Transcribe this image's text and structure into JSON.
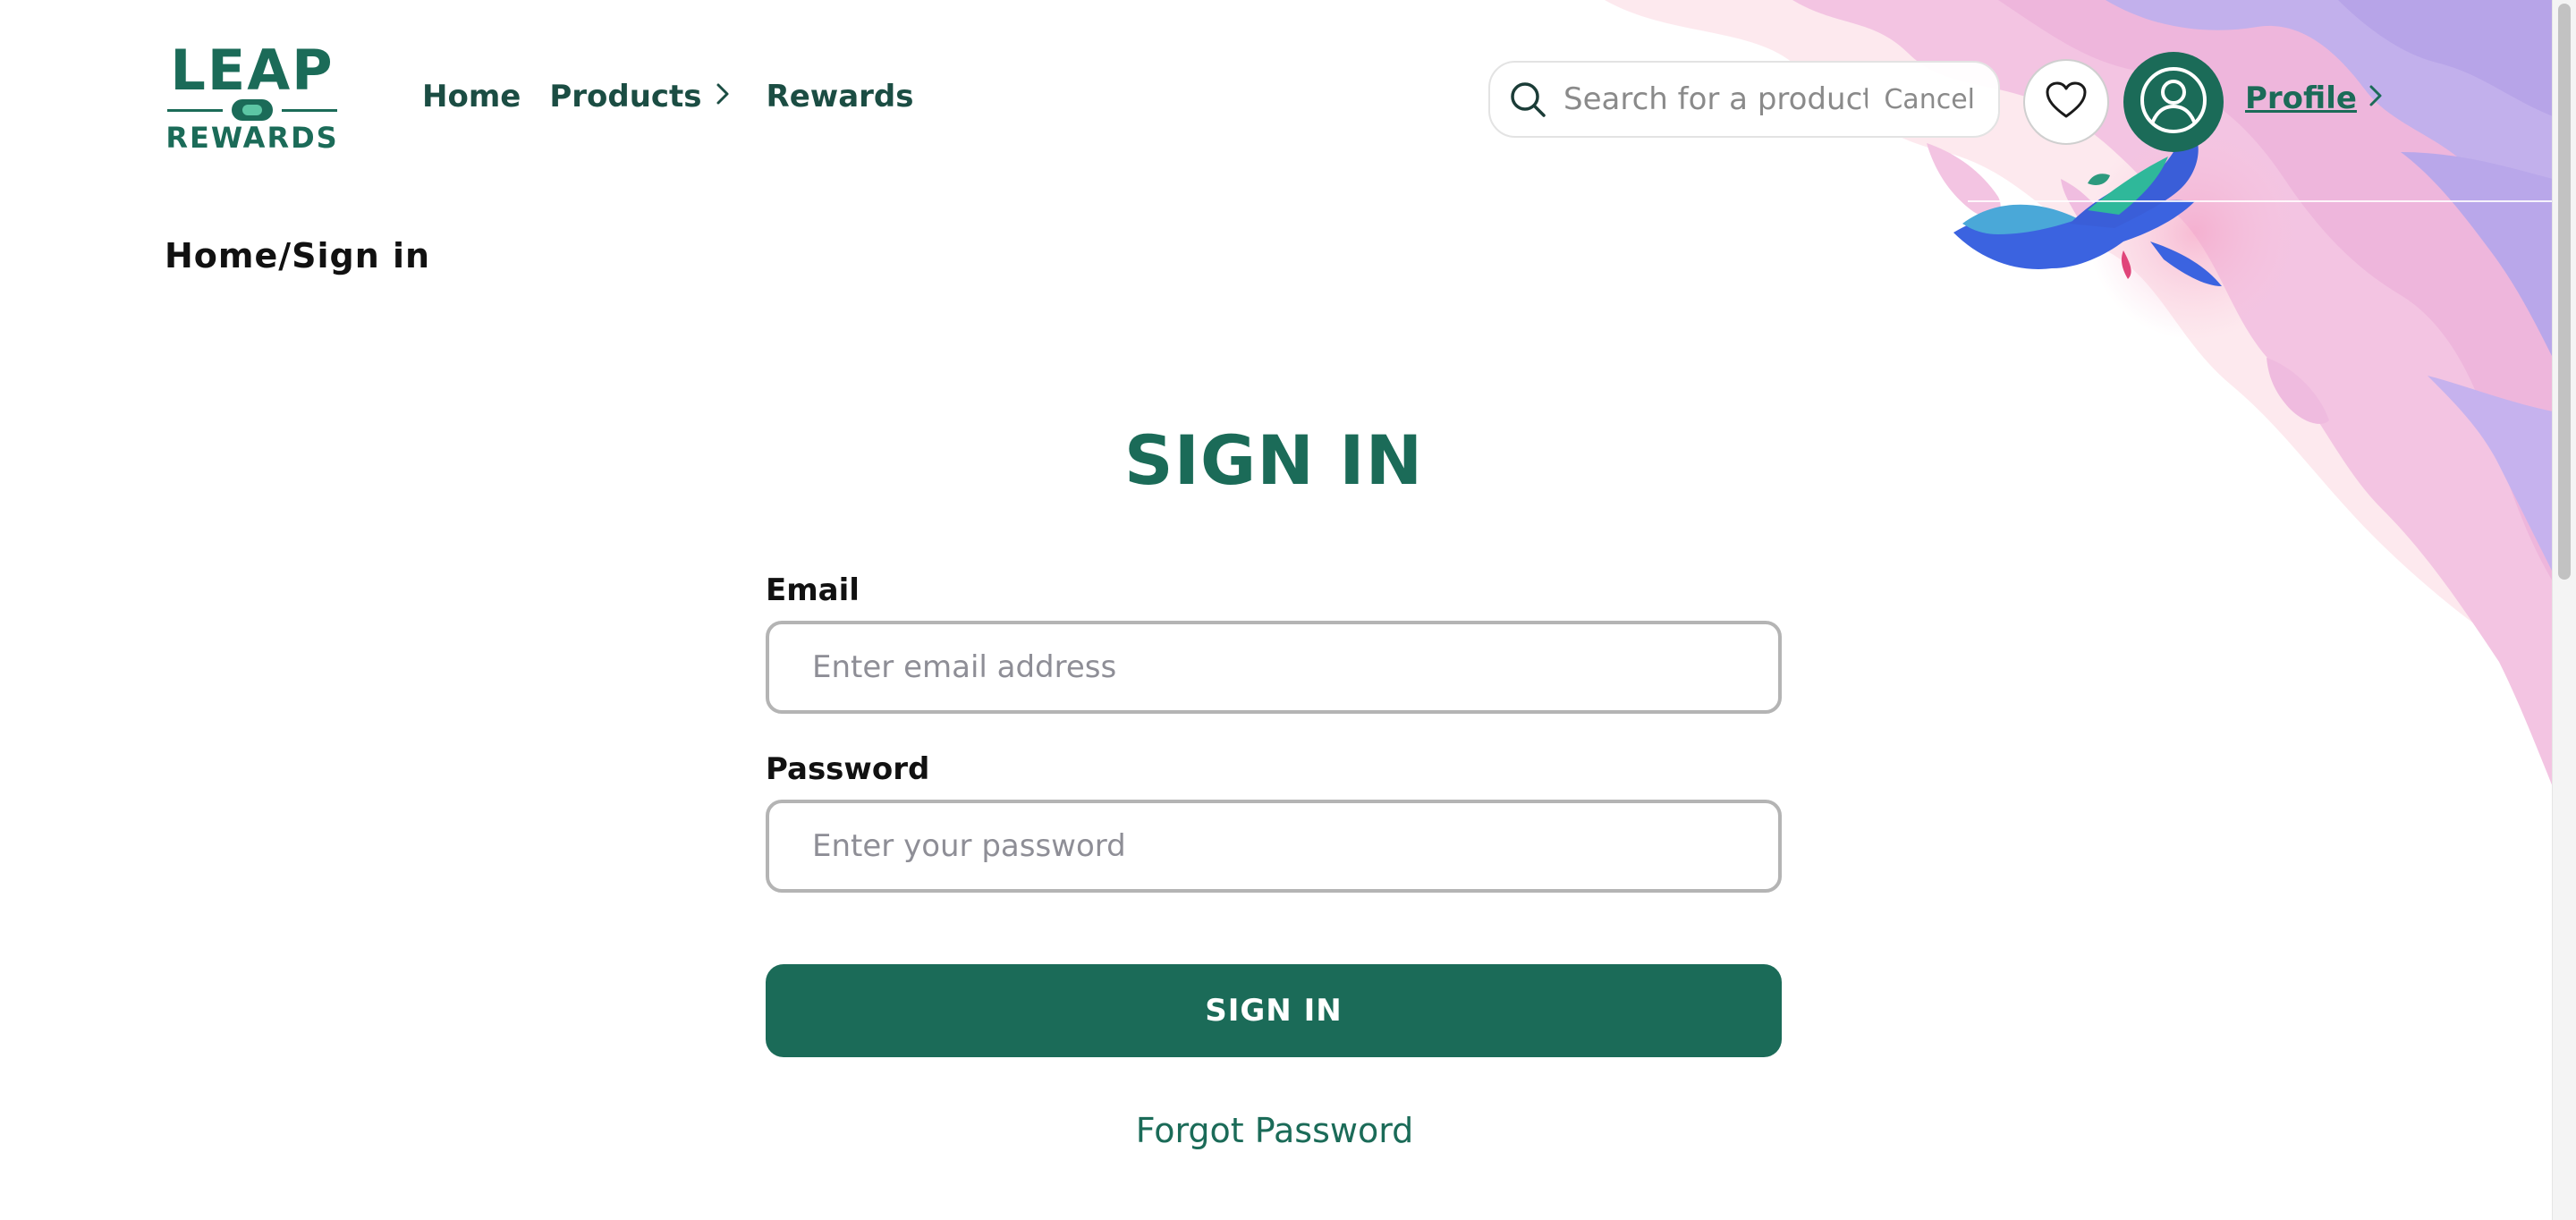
{
  "brand": {
    "logo_top": "LEAP",
    "logo_bottom": "REWARDS",
    "color": "#1b6b58"
  },
  "nav": {
    "home": "Home",
    "products": "Products",
    "rewards": "Rewards"
  },
  "search": {
    "placeholder": "Search for a product",
    "cancel": "Cancel"
  },
  "profile": {
    "label": "Profile"
  },
  "breadcrumb": "Home/Sign in",
  "signin": {
    "title": "SIGN IN",
    "email_label": "Email",
    "email_placeholder": "Enter email address",
    "password_label": "Password",
    "password_placeholder": "Enter your password",
    "button": "SIGN IN",
    "forgot": "Forgot Password"
  },
  "icons": {
    "search": "search-icon",
    "heart": "heart-icon",
    "user": "user-icon",
    "chevron": "chevron-right-icon"
  },
  "colors": {
    "primary": "#1b6b58",
    "nav_text": "#1b4d43",
    "input_border": "#b4b4b4",
    "deco_pink": "#f2bfe0",
    "deco_lavender": "#bfa9ea"
  }
}
